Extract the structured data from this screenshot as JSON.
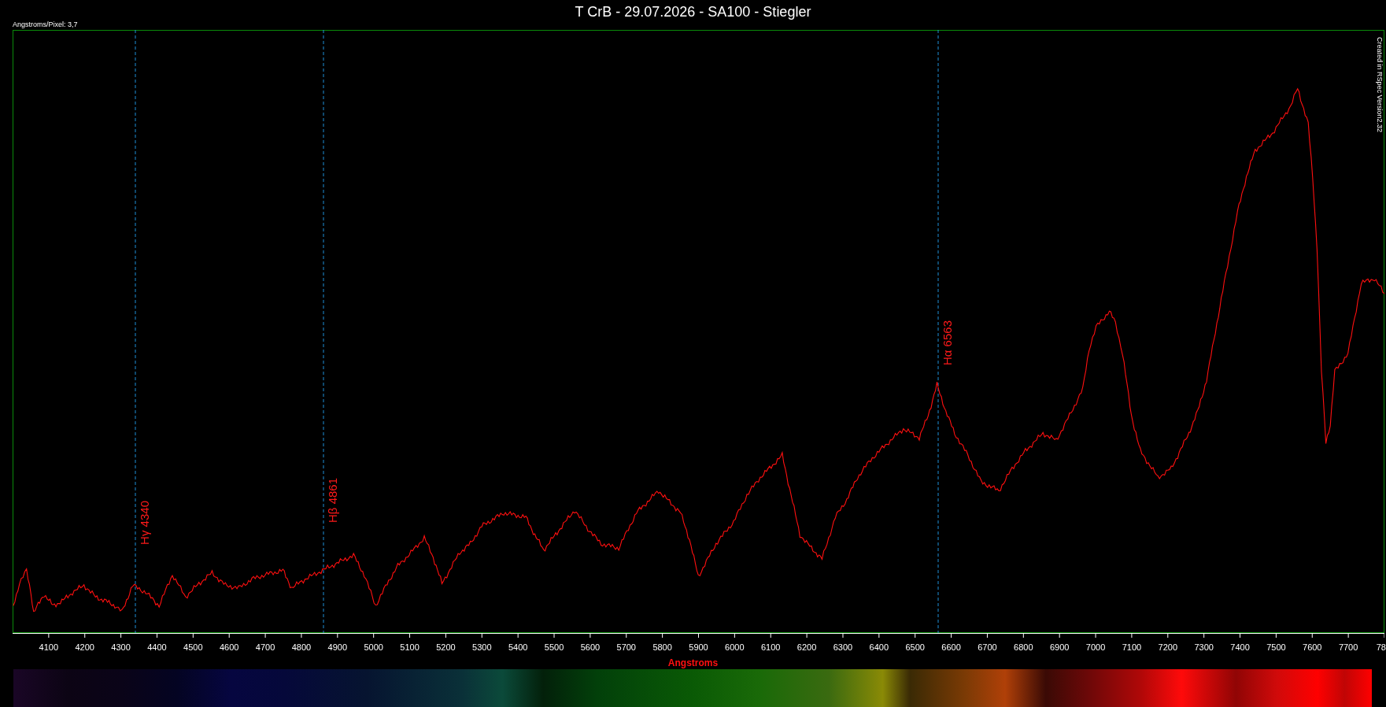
{
  "title": "T CrB - 29.07.2026 - SA100 - Stiegler",
  "scale_note": "Angstroms/Pixel: 3,7",
  "credit": "Created in RSpec Version2.32",
  "line_markers": [
    {
      "label": "Hγ 4340"
    },
    {
      "label": "Hβ 4861"
    },
    {
      "label": "Hα 6563"
    }
  ],
  "x_axis": {
    "label": "Angstroms",
    "ticks": [
      "4100",
      "4200",
      "4300",
      "4400",
      "4500",
      "4600",
      "4700",
      "4800",
      "4900",
      "5000",
      "5100",
      "5200",
      "5300",
      "5400",
      "5500",
      "5600",
      "5700",
      "5800",
      "5900",
      "6000",
      "6100",
      "6200",
      "6300",
      "6400",
      "6500",
      "6600",
      "6700",
      "6800",
      "6900",
      "7000",
      "7100",
      "7200",
      "7300",
      "7400",
      "7500",
      "7600",
      "7700",
      "78"
    ]
  }
}
